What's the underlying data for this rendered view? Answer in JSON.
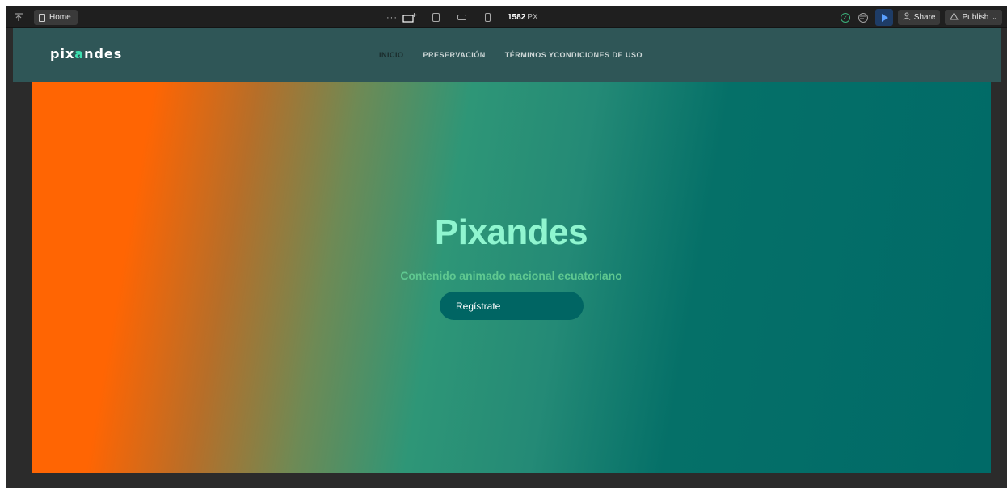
{
  "toolbar": {
    "page_name": "Home",
    "breakpoint_width": "1582",
    "breakpoint_unit": "PX",
    "share_label": "Share",
    "publish_label": "Publish",
    "accent_color": "#1e3c66"
  },
  "site": {
    "logo_text": "pixandes",
    "nav": [
      {
        "label": "INICIO",
        "active": true
      },
      {
        "label": "PRESERVACIÓN",
        "active": false
      },
      {
        "label": "TÉRMINOS YCONDICIONES DE USO",
        "active": false
      }
    ],
    "hero": {
      "title": "Pixandes",
      "subtitle": "Contenido animado nacional ecuatoriano",
      "cta_label": "Regístrate",
      "gradient_start": "#ff6503",
      "gradient_end": "#006a67"
    }
  }
}
